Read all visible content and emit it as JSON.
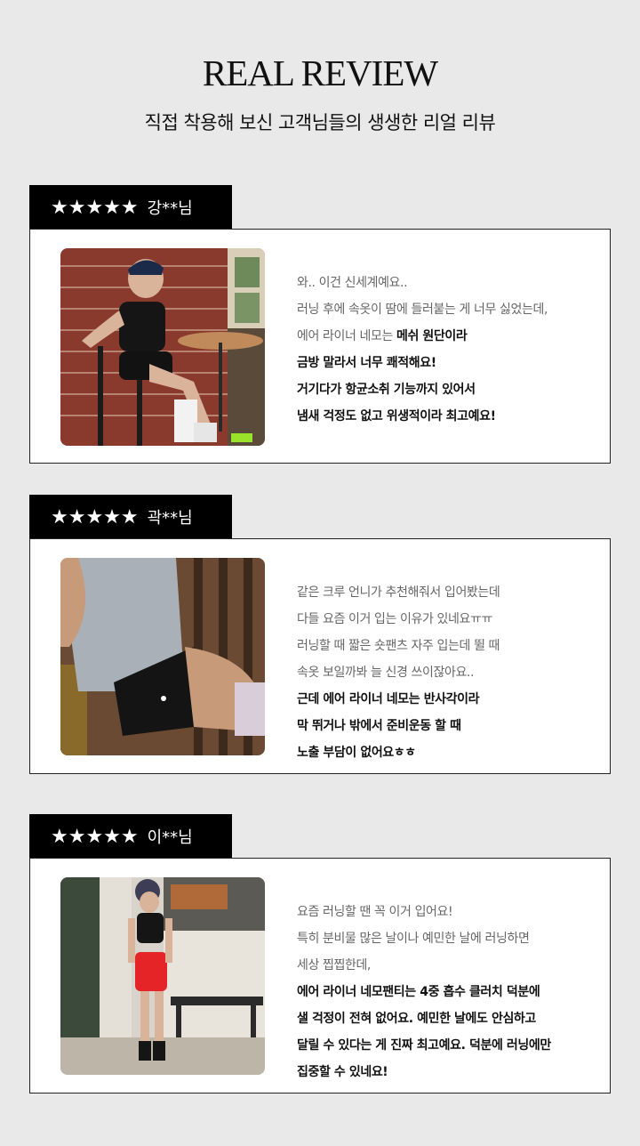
{
  "header": {
    "title": "REAL REVIEW",
    "subtitle": "직접 착용해 보신 고객님들의 생생한 리얼 리뷰"
  },
  "reviews": [
    {
      "stars": "★★★★★",
      "name": "강**님",
      "lines": [
        {
          "text": "와.. 이건 신세계예요..",
          "style": "light"
        },
        {
          "text": "러닝 후에 속옷이 땀에 들러붙는 게 너무 싫었는데,",
          "style": "light"
        },
        {
          "text": "에어 라이너 네모는 ",
          "style": "light",
          "tail": "메쉬 원단이라"
        },
        {
          "text": "금방 말라서 너무 쾌적해요!",
          "style": "bold"
        },
        {
          "text": "거기다가 항균소취 기능까지 있어서",
          "style": "bold"
        },
        {
          "text": "냄새 걱정도 없고 위생적이라 최고예요!",
          "style": "bold"
        }
      ]
    },
    {
      "stars": "★★★★★",
      "name": "곽**님",
      "lines": [
        {
          "text": "같은 크루 언니가 추천해줘서 입어봤는데",
          "style": "light"
        },
        {
          "text": "다들 요즘 이거 입는 이유가 있네요ㅠㅠ",
          "style": "light"
        },
        {
          "text": "러닝할 때 짧은 숏팬츠 자주 입는데 뛸 때",
          "style": "light"
        },
        {
          "text": "속옷 보일까봐 늘 신경 쓰이잖아요..",
          "style": "light"
        },
        {
          "text": "근데 에어 라이너 네모는 반사각이라",
          "style": "bold"
        },
        {
          "text": "막 뛰거나 밖에서 준비운동 할 때",
          "style": "bold"
        },
        {
          "text": "노출 부담이 없어요ㅎㅎ",
          "style": "bold"
        }
      ]
    },
    {
      "stars": "★★★★★",
      "name": "이**님",
      "lines": [
        {
          "text": "요즘 러닝할 땐 꼭 이거 입어요!",
          "style": "light"
        },
        {
          "text": "특히 분비물 많은 날이나 예민한 날에 러닝하면",
          "style": "light"
        },
        {
          "text": "세상 찝찝한데,",
          "style": "light"
        },
        {
          "text": "에어 라이너 네모팬티는 4중 흡수 클러치 덕분에",
          "style": "bold"
        },
        {
          "text": "샐 걱정이 전혀 없어요. 예민한 날에도 안심하고",
          "style": "bold"
        },
        {
          "text": "달릴 수 있다는 게 진짜 최고예요. 덕분에 러닝에만",
          "style": "bold"
        },
        {
          "text": "집중할 수 있네요!",
          "style": "bold"
        }
      ]
    }
  ]
}
